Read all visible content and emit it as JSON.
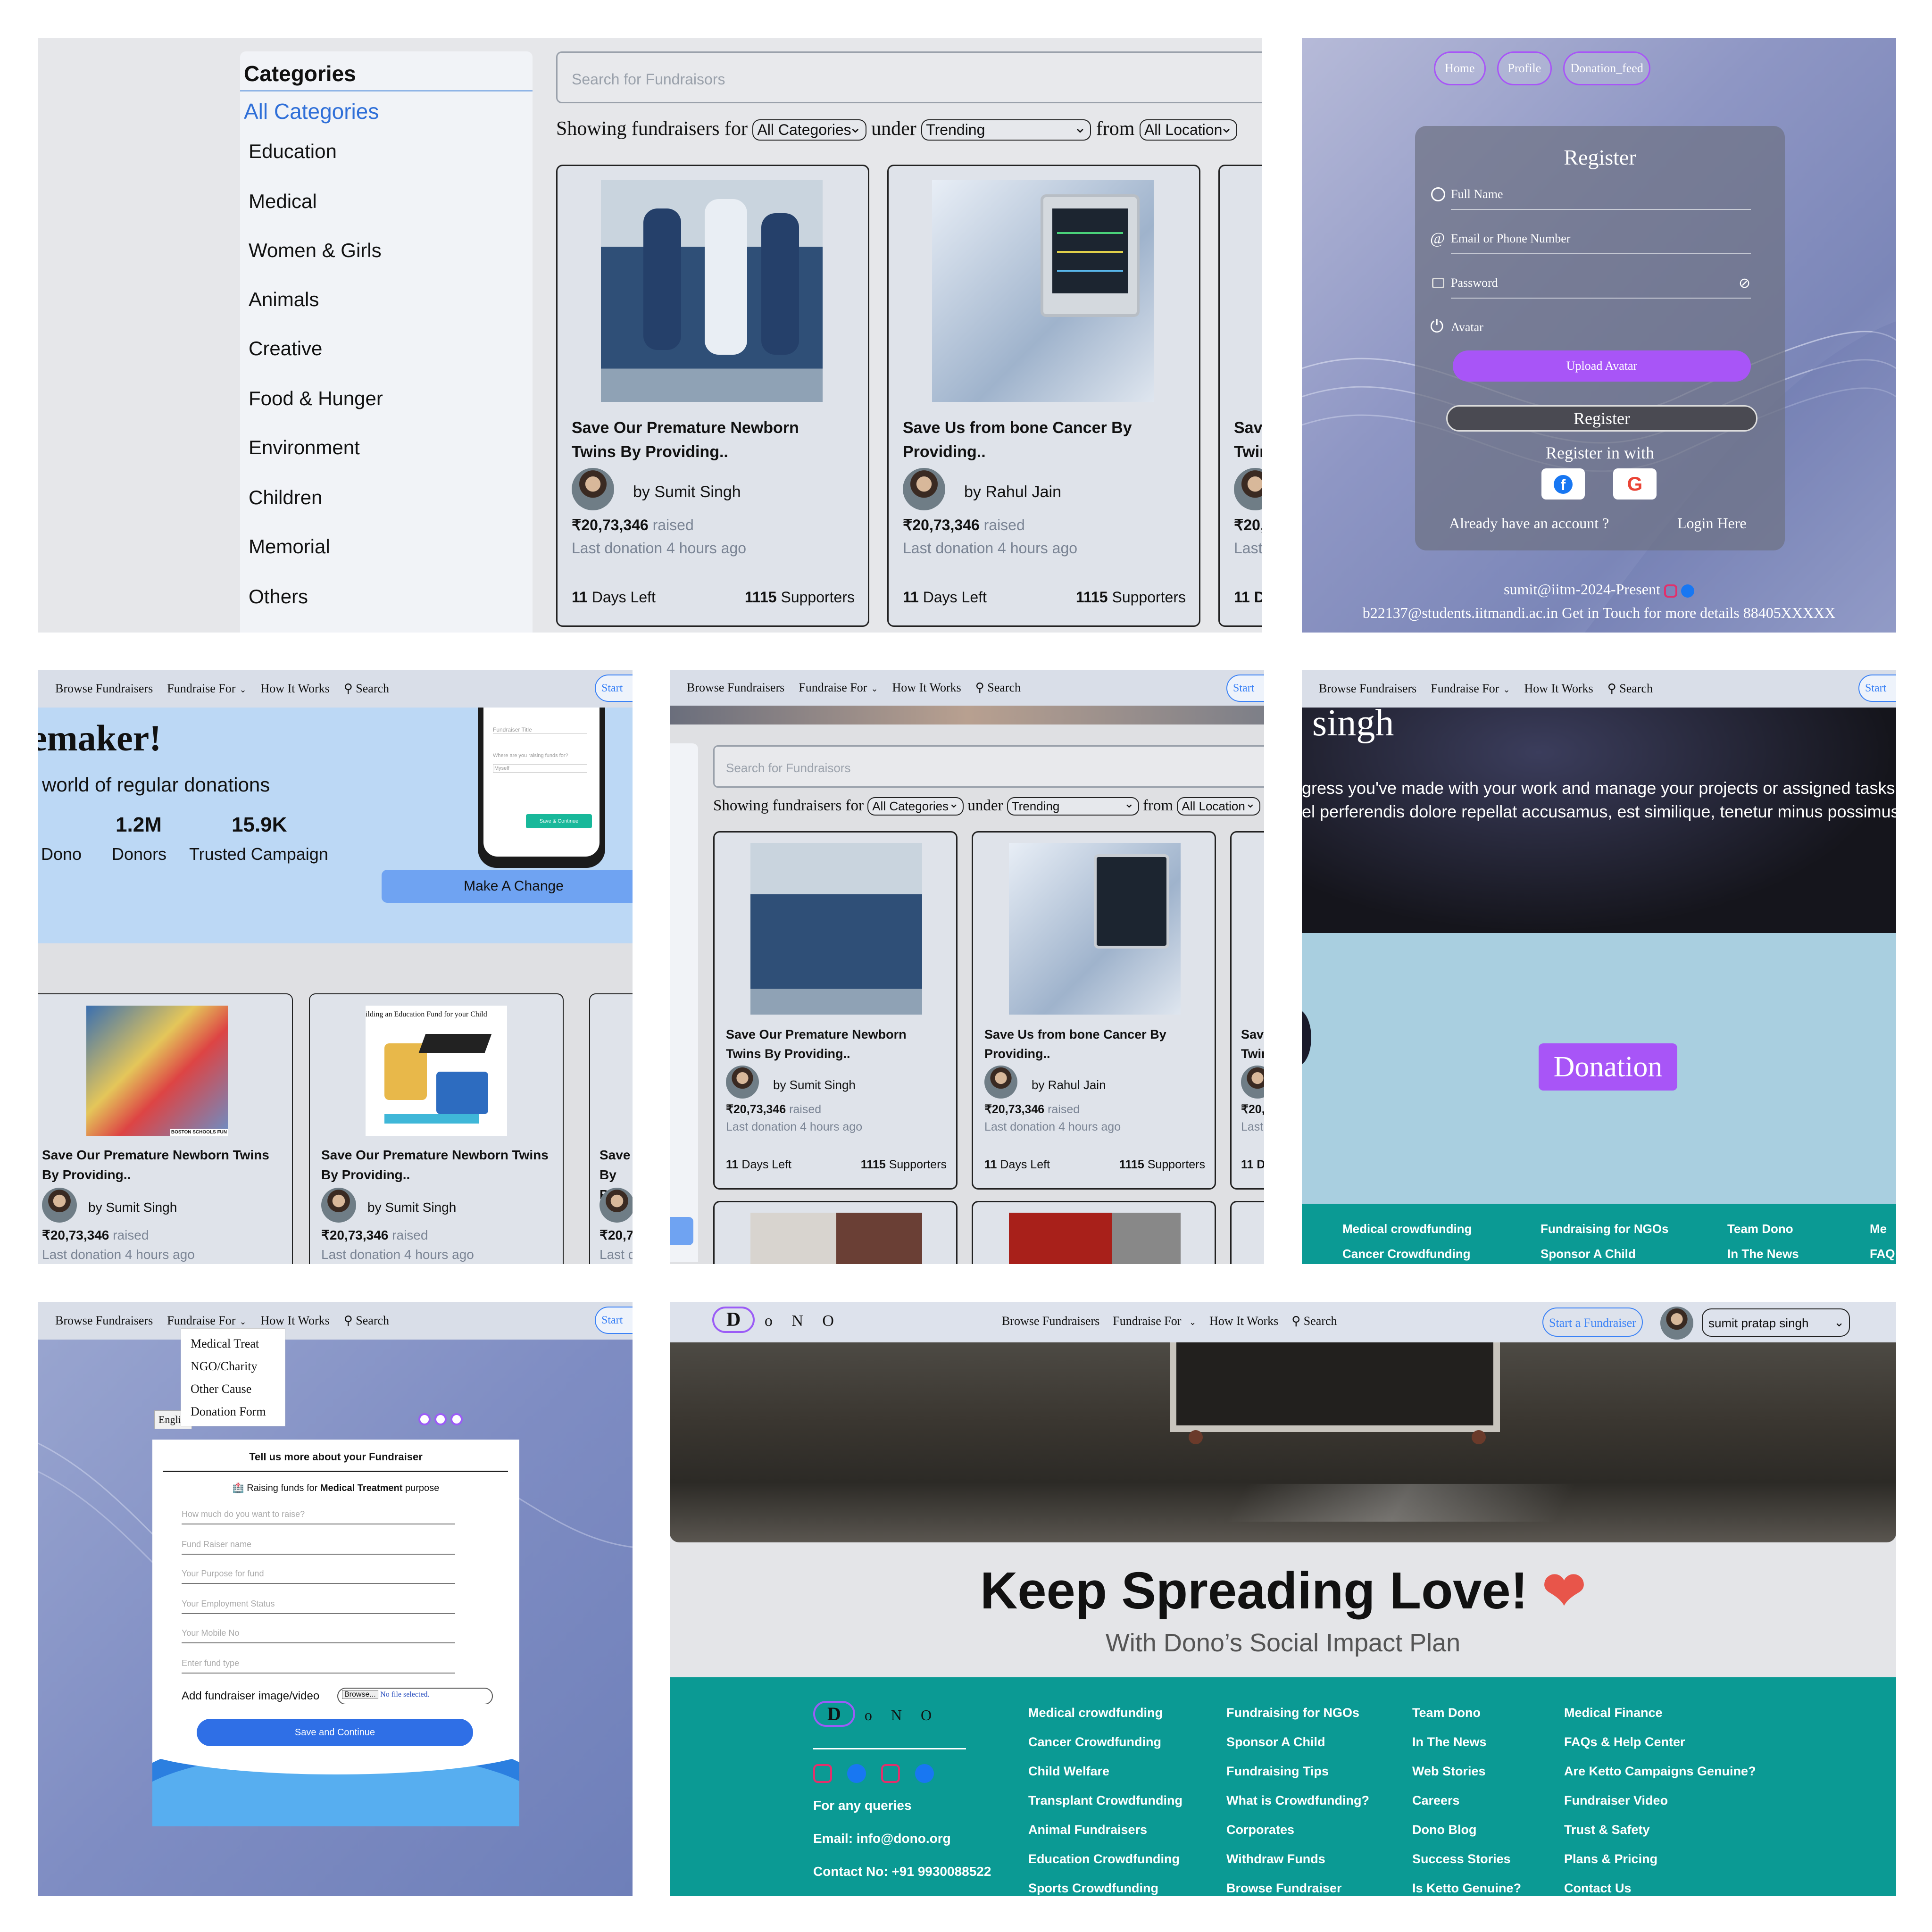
{
  "nav": {
    "browse": "Browse Fundraisers",
    "fundraise_for": "Fundraise For",
    "how": "How It Works",
    "search": "Search",
    "start": "Start a Fundraiser",
    "start_short": "Start"
  },
  "panel1": {
    "categories_title": "Categories",
    "categories": [
      "All Categories",
      "Education",
      "Medical",
      "Women & Girls",
      "Animals",
      "Creative",
      "Food & Hunger",
      "Environment",
      "Children",
      "Memorial",
      "Others"
    ],
    "search_placeholder": "Search for Fundraisors",
    "showing": "Showing fundraisers for",
    "under": "under",
    "from": "from",
    "sel_category": "All Categories",
    "sel_sort": "Trending",
    "sel_location": "All Location"
  },
  "cards": [
    {
      "title": "Save Our Premature Newborn Twins By Providing..",
      "by": "by Sumit Singh",
      "raised": "₹20,73,346",
      "raised_word": "raised",
      "last": "Last donation 4 hours ago",
      "days_num": "11",
      "days_word": "Days Left",
      "supp_num": "1115",
      "supp_word": "Supporters"
    },
    {
      "title": "Save Us from bone Cancer By Providing..",
      "by": "by Rahul Jain",
      "raised": "₹20,73,346",
      "raised_word": "raised",
      "last": "Last donation 4 hours ago",
      "days_num": "11",
      "days_word": "Days Left",
      "supp_num": "1115",
      "supp_word": "Supporters"
    },
    {
      "title": "Save Twin",
      "raised_short": "₹20,7",
      "last_short": "Last d",
      "days_short": "11 Da"
    }
  ],
  "register": {
    "nav": [
      "Home",
      "Profile",
      "Donation_feed"
    ],
    "title": "Register",
    "full_name": "Full Name",
    "email": "Email or Phone Number",
    "password": "Password",
    "avatar": "Avatar",
    "upload": "Upload Avatar",
    "register_btn": "Register",
    "register_with": "Register in with",
    "already": "Already have an account ?",
    "login": "Login Here",
    "footer1": "sumit@iitm-2024-Present",
    "footer2": "b22137@students.iitmandi.ac.in Get in Touch for more details 88405XXXXX"
  },
  "hero": {
    "title_fragment": "emaker!",
    "subtitle": "world of regular donations",
    "stat1_val": "1.2M",
    "stat1_label": "Donors",
    "stat2_val": "15.9K",
    "stat2_label": "Trusted Campaign",
    "stat0_label": "Dono",
    "make_change": "Make A Change",
    "phone_field1": "Fundraiser Title",
    "phone_field2": "Where are you raising funds for?",
    "phone_field3": "Myself",
    "phone_btn": "Save & Continue"
  },
  "hero_cards": [
    {
      "title": "Save Our Premature Newborn Twins By Providing..",
      "by": "by Sumit Singh",
      "raised": "₹20,73,346",
      "raised_word": "raised",
      "last": "Last donation 4 hours ago",
      "img_caption": "BOSTON SCHOOLS FUN"
    },
    {
      "title": "Save Our Premature Newborn Twins By Providing..",
      "by": "by Sumit Singh",
      "raised": "₹20,73,346",
      "raised_word": "raised",
      "last": "Last donation 4 hours ago",
      "img_caption": "ilding an Education Fund for your Child"
    },
    {
      "title": "Save By Pr",
      "raised_short": "₹20,7",
      "last_short": "Last d"
    }
  ],
  "profile": {
    "name_fragment": "singh",
    "line1": "gress you've made with your work and manage your projects or assigned tasks",
    "line2": "el perferendis dolore repellat accusamus, est similique, tenetur minus possimus",
    "donation_btn": "Donation",
    "footer_cols": [
      {
        "head": "Medical crowdfunding",
        "item": "Cancer Crowdfunding"
      },
      {
        "head": "Fundraising for NGOs",
        "item": "Sponsor A Child"
      },
      {
        "head": "Team Dono",
        "item": "In The News"
      },
      {
        "head": "Me",
        "item": "FAQ"
      }
    ]
  },
  "form": {
    "dropdown": [
      "Medical Treat",
      "NGO/Charity",
      "Other Cause",
      "Donation Form"
    ],
    "lang": "Engli",
    "heading": "Tell us more about your Fundraiser",
    "raising_pre": "Raising funds for",
    "raising_bold": "Medical Treatment",
    "raising_post": "purpose",
    "fields": [
      "How much do you want to raise?",
      "Fund Raiser name",
      "Your Purpose for fund",
      "Your Employment Status",
      "Your Mobile No",
      "Enter fund type"
    ],
    "add_image": "Add fundraiser image/video",
    "browse": "Browse...",
    "no_file": "No file selected.",
    "save": "Save and Continue"
  },
  "home": {
    "logo": [
      "D",
      "o",
      "N",
      "O"
    ],
    "user": "sumit pratap singh",
    "headline": "Keep Spreading Love!",
    "sub": "With Dono’s Social Impact Plan",
    "for_queries": "For any queries",
    "email": "Email: info@dono.org",
    "contact": "Contact No: +91 9930088522",
    "columns": [
      [
        "Medical crowdfunding",
        "Cancer Crowdfunding",
        "Child Welfare",
        "Transplant Crowdfunding",
        "Animal Fundraisers",
        "Education Crowdfunding",
        "Sports Crowdfunding"
      ],
      [
        "Fundraising for NGOs",
        "Sponsor A Child",
        "Fundraising Tips",
        "What is Crowdfunding?",
        "Corporates",
        "Withdraw Funds",
        "Browse Fundraiser"
      ],
      [
        "Team Dono",
        "In The News",
        "Web Stories",
        "Careers",
        "Dono Blog",
        "Success Stories",
        "Is Ketto Genuine?"
      ],
      [
        "Medical Finance",
        "FAQs & Help Center",
        "Are Ketto Campaigns Genuine?",
        "Fundraiser Video",
        "Trust & Safety",
        "Plans & Pricing",
        "Contact Us"
      ]
    ]
  },
  "colors": {
    "teal": "#0b9a94",
    "accent": "#3b82f6",
    "purple": "#9b5cf6"
  }
}
